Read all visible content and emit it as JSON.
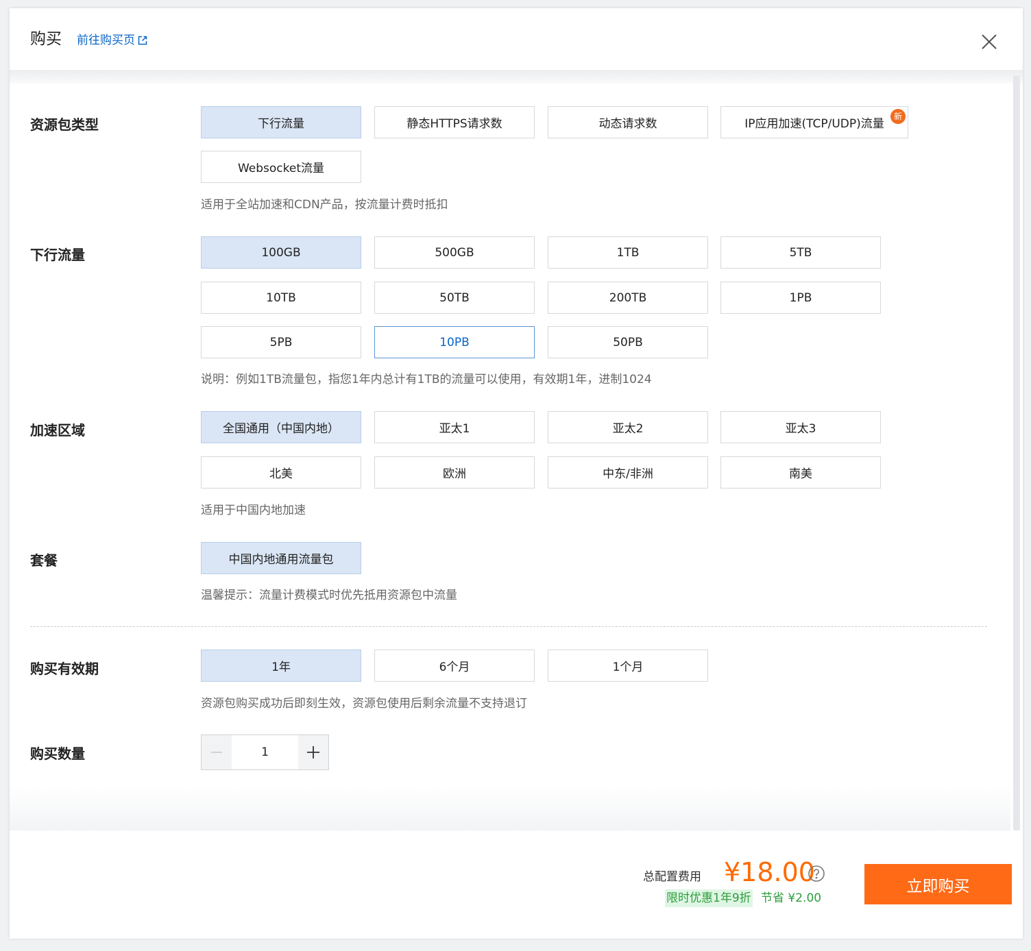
{
  "header": {
    "title": "购买",
    "link_label": "前往购买页"
  },
  "resource_type": {
    "label": "资源包类型",
    "options": [
      "下行流量",
      "静态HTTPS请求数",
      "动态请求数",
      "IP应用加速(TCP/UDP)流量",
      "Websocket流量"
    ],
    "selected": "下行流量",
    "new_badge": "新",
    "hint": "适用于全站加速和CDN产品，按流量计费时抵扣"
  },
  "traffic": {
    "label": "下行流量",
    "options": [
      "100GB",
      "500GB",
      "1TB",
      "5TB",
      "10TB",
      "50TB",
      "200TB",
      "1PB",
      "5PB",
      "10PB",
      "50PB"
    ],
    "selected": "100GB",
    "hint": "说明：例如1TB流量包，指您1年内总计有1TB的流量可以使用，有效期1年，进制1024"
  },
  "region": {
    "label": "加速区域",
    "options": [
      "全国通用（中国内地）",
      "亚太1",
      "亚太2",
      "亚太3",
      "北美",
      "欧洲",
      "中东/非洲",
      "南美"
    ],
    "selected": "全国通用（中国内地）",
    "hint": "适用于中国内地加速"
  },
  "package": {
    "label": "套餐",
    "options": [
      "中国内地通用流量包"
    ],
    "selected": "中国内地通用流量包",
    "hint": "温馨提示：流量计费模式时优先抵用资源包中流量"
  },
  "duration": {
    "label": "购买有效期",
    "options": [
      "1年",
      "6个月",
      "1个月"
    ],
    "selected": "1年",
    "hint": "资源包购买成功后即刻生效，资源包使用后剩余流量不支持退订"
  },
  "quantity": {
    "label": "购买数量",
    "value": "1"
  },
  "footer": {
    "fee_label": "总配置费用",
    "price": "¥18.00",
    "promo": "限时优惠1年9折",
    "save": "节省 ¥2.00",
    "buy_label": "立即购买"
  },
  "colors": {
    "accent": "#ff6a16",
    "link": "#0a64c8",
    "selected_bg": "#dae6f5",
    "promo_green": "#2e9d3e"
  },
  "icons": [
    "external-link-icon",
    "close-icon",
    "minus-icon",
    "plus-icon",
    "question-icon"
  ]
}
